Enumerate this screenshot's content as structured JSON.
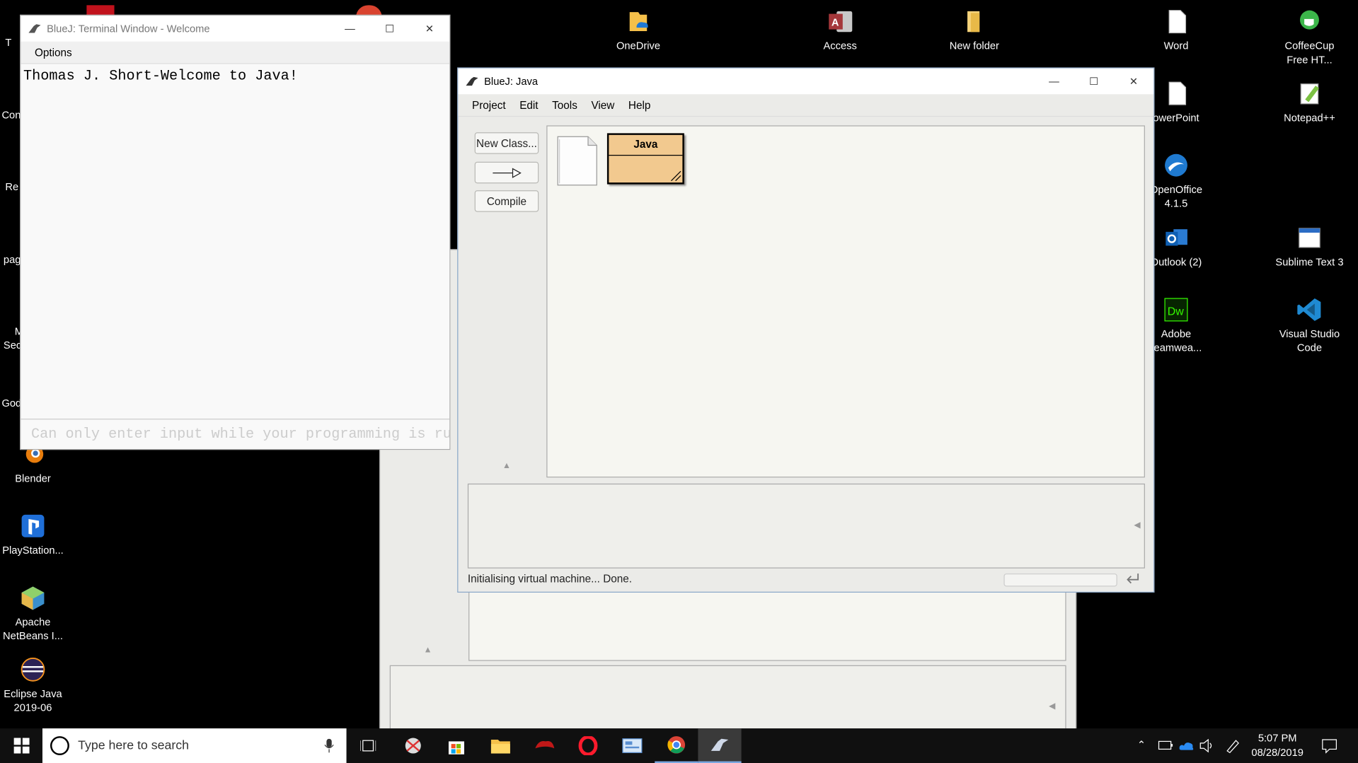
{
  "desktop": {
    "left_icons": [
      {
        "label": "Blender",
        "icon": "blender-icon"
      },
      {
        "label": "PlayStation...",
        "icon": "playstation-icon"
      },
      {
        "label": "Apache NetBeans I...",
        "icon": "netbeans-icon"
      },
      {
        "label": "Eclipse Java 2019-06",
        "icon": "eclipse-icon"
      }
    ],
    "left_partial": [
      "T",
      "Con",
      "Re",
      "pag",
      "M",
      "Sec",
      "God"
    ],
    "top_icons": [
      {
        "label": "OneDrive",
        "icon": "onedrive-folder-icon"
      },
      {
        "label": "Access",
        "icon": "access-icon"
      },
      {
        "label": "New folder",
        "icon": "folder-icon"
      }
    ],
    "right_col1": [
      {
        "label": "Word",
        "icon": "word-icon"
      },
      {
        "label": "owerPoint",
        "icon": "powerpoint-icon"
      },
      {
        "label": "OpenOffice 4.1.5",
        "icon": "openoffice-icon"
      },
      {
        "label": "Outlook (2)",
        "icon": "outlook-icon"
      },
      {
        "label": "Adobe reamwea...",
        "icon": "dreamweaver-icon"
      }
    ],
    "right_col2": [
      {
        "label": "CoffeeCup Free HT...",
        "icon": "coffeecup-icon"
      },
      {
        "label": "Notepad++",
        "icon": "notepadpp-icon"
      },
      {
        "label": "Sublime Text 3",
        "icon": "sublime-icon"
      },
      {
        "label": "Visual Studio Code",
        "icon": "vscode-icon"
      }
    ]
  },
  "terminal": {
    "title": "BlueJ: Terminal Window - Welcome",
    "menu": [
      "Options"
    ],
    "output": "Thomas J. Short-Welcome to Java!",
    "input_placeholder": "Can only enter input while your programming is ru"
  },
  "bluej": {
    "title": "BlueJ:  Java",
    "menu": [
      "Project",
      "Edit",
      "Tools",
      "View",
      "Help"
    ],
    "buttons": {
      "new_class": "New Class...",
      "compile": "Compile"
    },
    "class_name": "Java",
    "status": "Initialising virtual machine... Done."
  },
  "taskbar": {
    "search_placeholder": "Type here to search",
    "time": "5:07 PM",
    "date": "08/28/2019"
  },
  "colors": {
    "class_box": "#f2c98f",
    "taskbar": "#101010",
    "window_bg": "#ebebe8"
  }
}
